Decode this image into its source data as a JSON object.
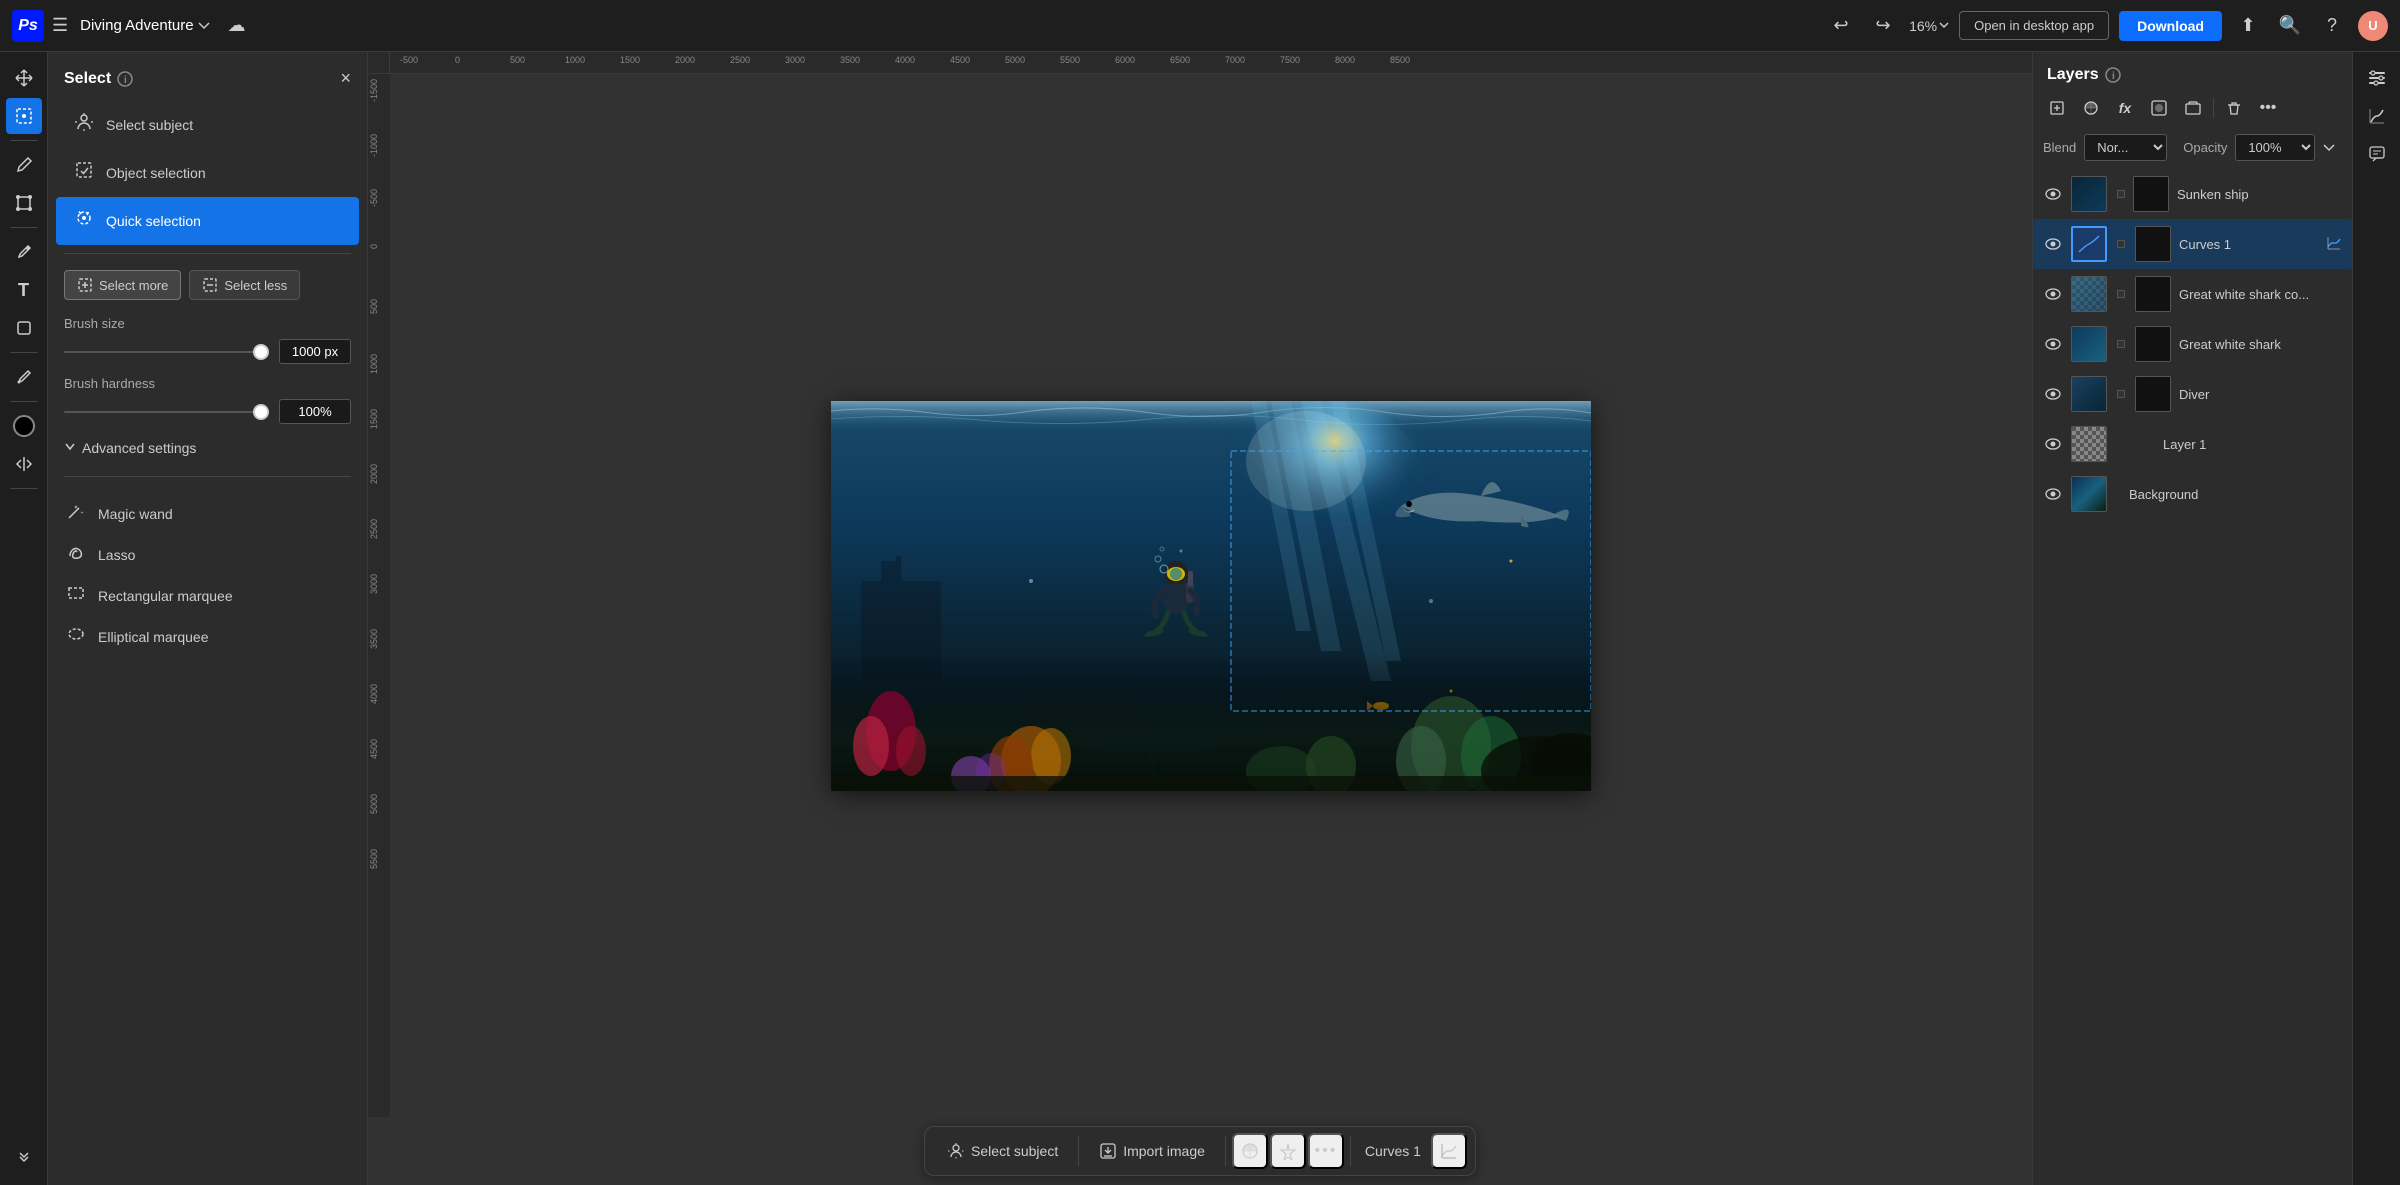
{
  "app": {
    "logo": "Ps",
    "doc_title": "Diving Adventure",
    "zoom_level": "16%"
  },
  "topbar": {
    "hamburger_label": "☰",
    "cloud_icon": "☁",
    "open_desktop_label": "Open in desktop app",
    "download_label": "Download",
    "search_icon": "🔍",
    "help_icon": "?",
    "avatar_initials": "U"
  },
  "select_panel": {
    "title": "Select",
    "close_icon": "×",
    "items": [
      {
        "id": "select-subject",
        "label": "Select subject",
        "icon": "👤"
      },
      {
        "id": "object-selection",
        "label": "Object selection",
        "icon": "⬜"
      },
      {
        "id": "quick-selection",
        "label": "Quick selection",
        "icon": "🖌",
        "active": true
      }
    ],
    "select_more_label": "Select more",
    "select_less_label": "Select less",
    "brush_size_label": "Brush size",
    "brush_size_value": "1000 px",
    "brush_hardness_label": "Brush hardness",
    "brush_hardness_value": "100%",
    "advanced_settings_label": "Advanced settings",
    "tools": [
      {
        "id": "magic-wand",
        "label": "Magic wand",
        "icon": "✦"
      },
      {
        "id": "lasso",
        "label": "Lasso",
        "icon": "⟲"
      },
      {
        "id": "rectangular-marquee",
        "label": "Rectangular marquee",
        "icon": "⬚"
      },
      {
        "id": "elliptical-marquee",
        "label": "Elliptical marquee",
        "icon": "◯"
      }
    ]
  },
  "left_toolbar": {
    "tools": [
      {
        "id": "move",
        "icon": "✛",
        "active": false
      },
      {
        "id": "select",
        "icon": "◈",
        "active": true
      },
      {
        "id": "brush",
        "icon": "✏",
        "active": false
      },
      {
        "id": "transform",
        "icon": "⊞",
        "active": false
      },
      {
        "id": "pen",
        "icon": "✒",
        "active": false
      },
      {
        "id": "type",
        "icon": "T",
        "active": false
      },
      {
        "id": "shape",
        "icon": "◻",
        "active": false
      },
      {
        "id": "eyedropper",
        "icon": "✦",
        "active": false
      },
      {
        "id": "fill",
        "icon": "●",
        "active": false,
        "special": "circle-black"
      },
      {
        "id": "sort",
        "icon": "⇅",
        "active": false
      }
    ]
  },
  "canvas": {
    "ruler_labels_h": [
      "-500",
      "",
      "0",
      "",
      "500",
      "",
      "1000",
      "",
      "1500",
      "",
      "2000",
      "",
      "2500",
      "",
      "3000",
      "",
      "3500",
      "",
      "4000",
      "",
      "4500",
      "",
      "5000",
      "",
      "5500",
      "",
      "6000",
      "",
      "6500",
      "",
      "7000",
      "",
      "7500",
      "",
      "8000",
      "",
      "8500"
    ],
    "ruler_labels_v": [
      "-1500",
      "-1000",
      "-500",
      "0",
      "500",
      "1000",
      "1500",
      "2000",
      "2500",
      "3000",
      "3500",
      "4000",
      "4500",
      "5000",
      "5500"
    ]
  },
  "bottom_bar": {
    "select_subject_label": "Select subject",
    "import_image_label": "Import image",
    "more_label": "...",
    "curves_label": "Curves 1",
    "adjust_icon": "⊞"
  },
  "layers_panel": {
    "title": "Layers",
    "blend_label": "Blend",
    "blend_value": "Nor...",
    "opacity_label": "Opacity",
    "opacity_value": "100%",
    "layers": [
      {
        "id": "sunken-ship",
        "name": "Sunken ship",
        "visible": true,
        "has_mask": true,
        "selected": false,
        "thumb_type": "dark-ocean"
      },
      {
        "id": "curves-1",
        "name": "Curves 1",
        "visible": true,
        "has_mask": true,
        "selected": true,
        "thumb_type": "curves"
      },
      {
        "id": "great-white-co",
        "name": "Great white shark co...",
        "visible": true,
        "has_mask": true,
        "selected": false,
        "thumb_type": "checker"
      },
      {
        "id": "great-white",
        "name": "Great white shark",
        "visible": true,
        "has_mask": true,
        "selected": false,
        "thumb_type": "dark-ocean"
      },
      {
        "id": "diver",
        "name": "Diver",
        "visible": true,
        "has_mask": true,
        "selected": false,
        "thumb_type": "dark"
      },
      {
        "id": "layer-1",
        "name": "Layer 1",
        "visible": true,
        "has_mask": false,
        "selected": false,
        "thumb_type": "checker"
      },
      {
        "id": "background",
        "name": "Background",
        "visible": true,
        "has_mask": false,
        "selected": false,
        "thumb_type": "bg"
      }
    ]
  },
  "right_mini_toolbar": {
    "tools": [
      {
        "id": "properties",
        "icon": "≡"
      },
      {
        "id": "adjustments",
        "icon": "≈"
      },
      {
        "id": "comments",
        "icon": "💬"
      }
    ]
  }
}
